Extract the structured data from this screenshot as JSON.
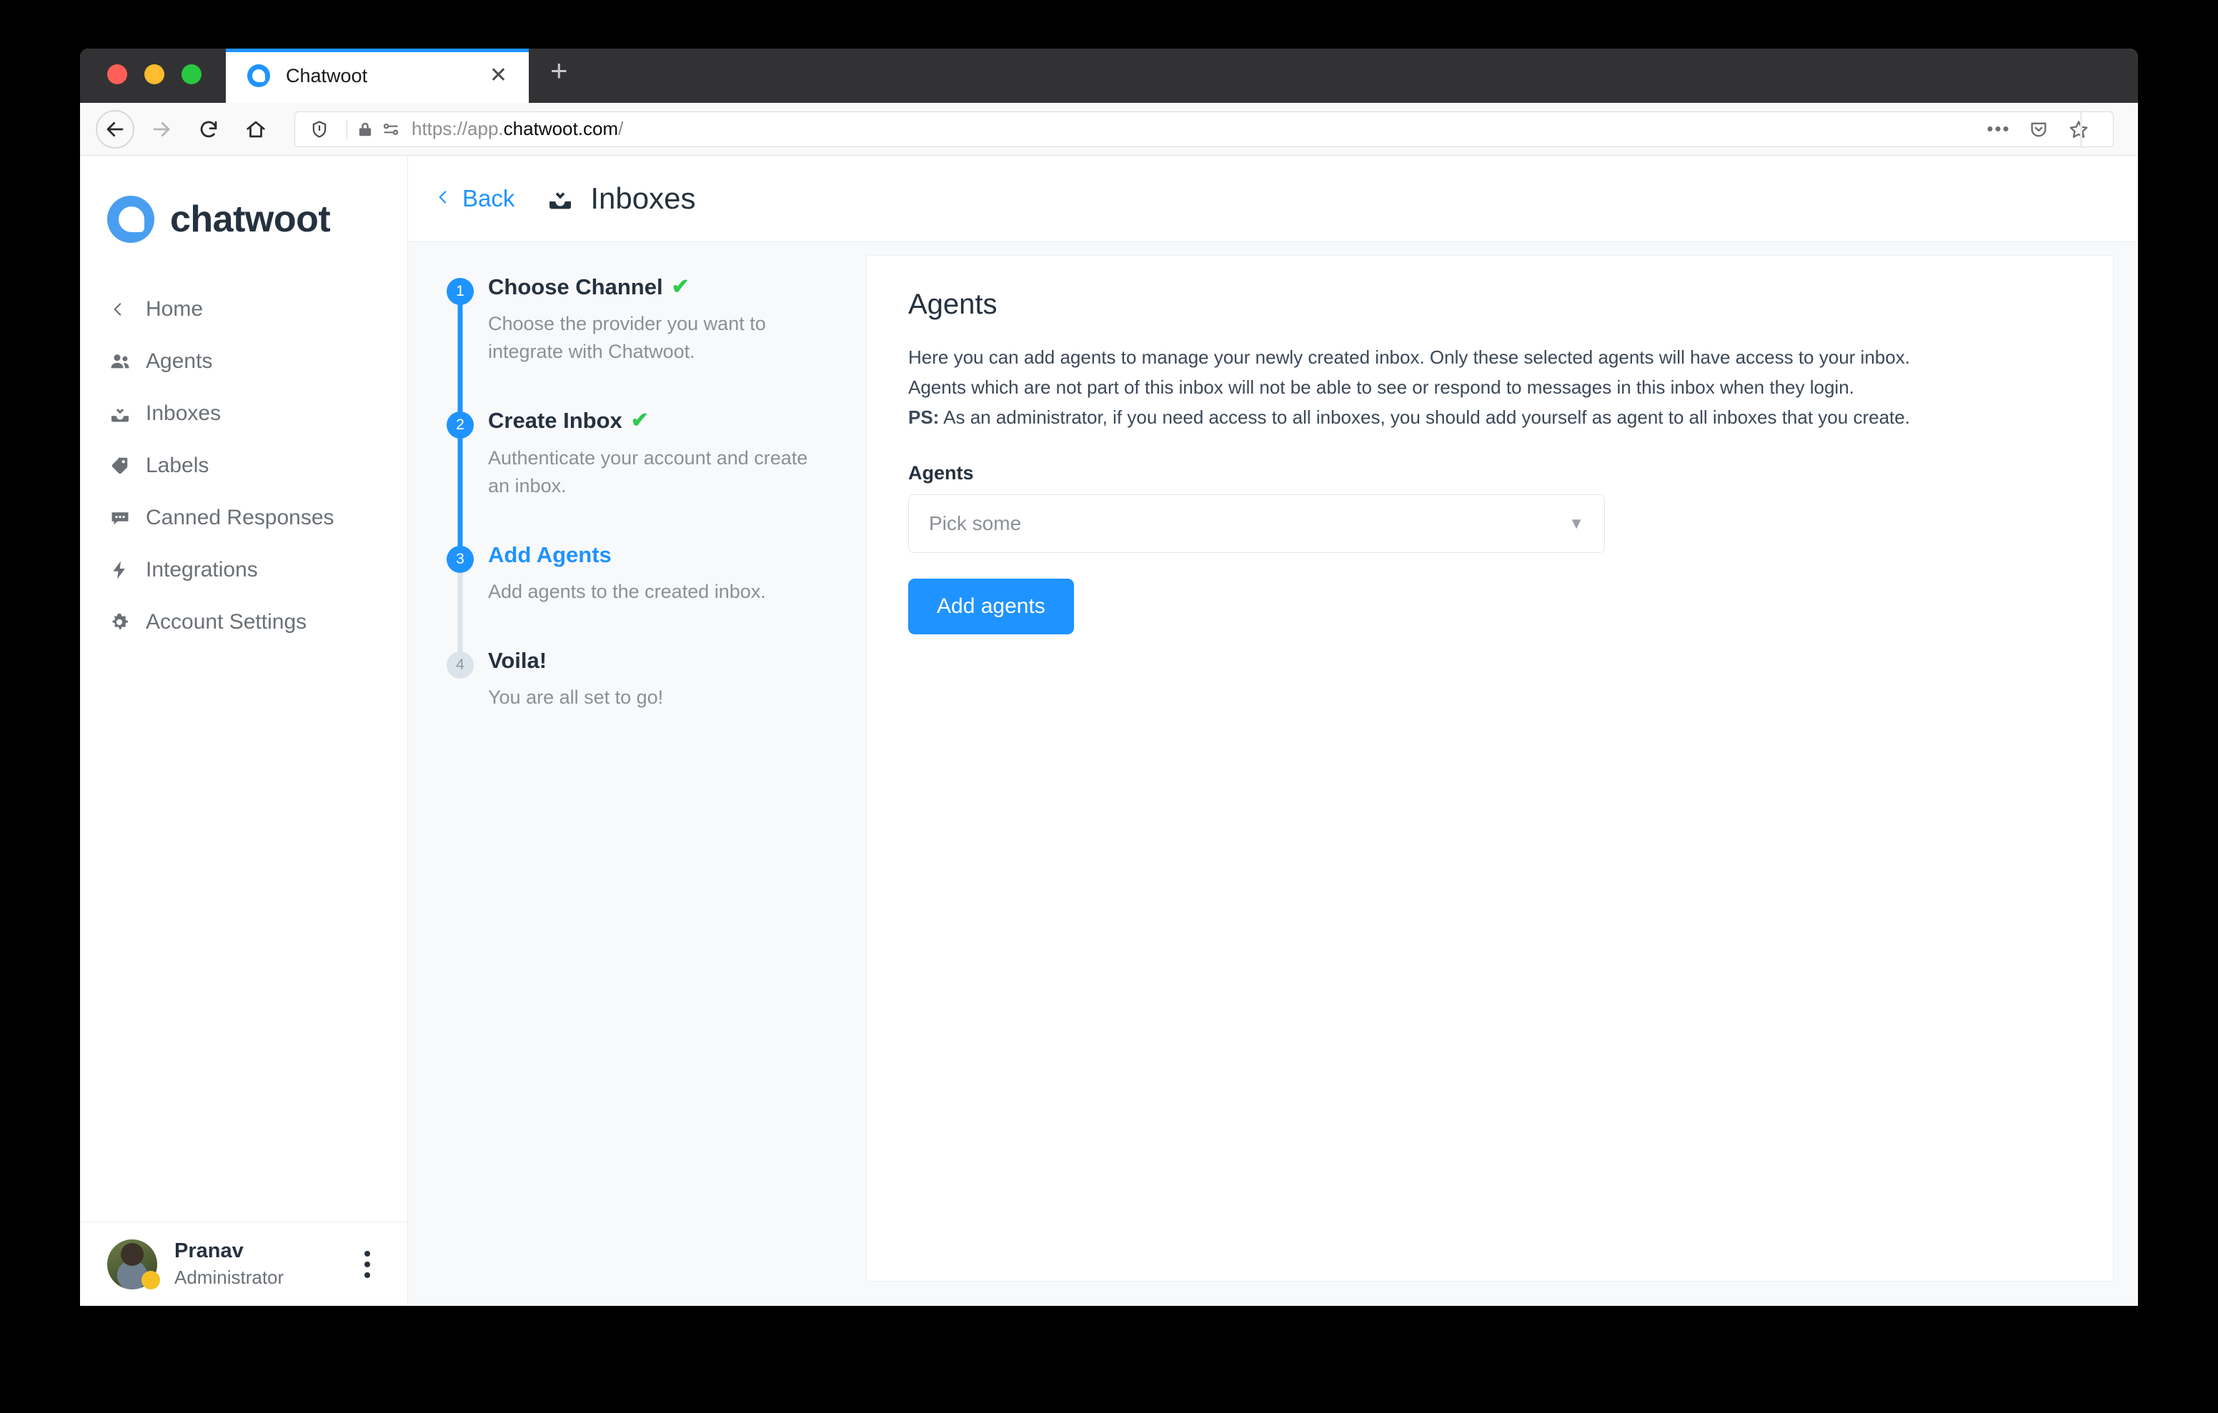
{
  "browser": {
    "tab": {
      "title": "Chatwoot",
      "favicon": "chatwoot-logo-icon",
      "close": "✕"
    },
    "new_tab": "+",
    "nav": {
      "back": "←",
      "forward": "→",
      "reload": "⟳",
      "home": "⌂"
    },
    "url": {
      "scheme_host_prefix": "https://app.",
      "host_highlight": "chatwoot.com",
      "path_suffix": "/",
      "shield_icon": "shield-icon",
      "lock_icon": "lock-icon",
      "permissions_icon": "permissions-icon"
    },
    "url_actions": {
      "page_actions": "•••",
      "pocket": "pocket-icon",
      "bookmark": "star-icon"
    }
  },
  "sidebar": {
    "brand": {
      "name": "chatwoot",
      "logo": "chatwoot-logo-icon"
    },
    "items": [
      {
        "label": "Home",
        "icon": "chevron-left-icon"
      },
      {
        "label": "Agents",
        "icon": "users-icon"
      },
      {
        "label": "Inboxes",
        "icon": "inbox-icon"
      },
      {
        "label": "Labels",
        "icon": "tag-icon"
      },
      {
        "label": "Canned Responses",
        "icon": "chat-icon"
      },
      {
        "label": "Integrations",
        "icon": "bolt-icon"
      },
      {
        "label": "Account Settings",
        "icon": "gear-icon"
      }
    ],
    "user": {
      "name": "Pranav",
      "role": "Administrator",
      "avatar": "user-avatar",
      "status": "away",
      "menu_icon": "kebab-menu-icon"
    }
  },
  "header": {
    "back_label": "Back",
    "back_icon": "chevron-left-icon",
    "title_icon": "inbox-icon",
    "title": "Inboxes"
  },
  "wizard": {
    "steps": [
      {
        "number": "1",
        "title": "Choose Channel",
        "description": "Choose the provider you want to integrate with Chatwoot.",
        "state": "complete",
        "check": "✔"
      },
      {
        "number": "2",
        "title": "Create Inbox",
        "description": "Authenticate your account and create an inbox.",
        "state": "complete",
        "check": "✔"
      },
      {
        "number": "3",
        "title": "Add Agents",
        "description": "Add agents to the created inbox.",
        "state": "current",
        "check": ""
      },
      {
        "number": "4",
        "title": "Voila!",
        "description": "You are all set to go!",
        "state": "upcoming",
        "check": ""
      }
    ]
  },
  "main": {
    "title": "Agents",
    "paragraph_1": "Here you can add agents to manage your newly created inbox. Only these selected agents will have access to your inbox.",
    "paragraph_2": "Agents which are not part of this inbox will not be able to see or respond to messages in this inbox when they login.",
    "ps_label": "PS:",
    "ps_text": " As an administrator, if you need access to all inboxes, you should add yourself as agent to all inboxes that you create.",
    "field_label": "Agents",
    "select_placeholder": "Pick some",
    "select_caret": "▼",
    "submit_label": "Add agents"
  },
  "colors": {
    "accent": "#1f93ff",
    "success": "#2fcb4f",
    "text_dark": "#25313f",
    "text_muted": "#8b9096",
    "status_away": "#f5c024"
  }
}
